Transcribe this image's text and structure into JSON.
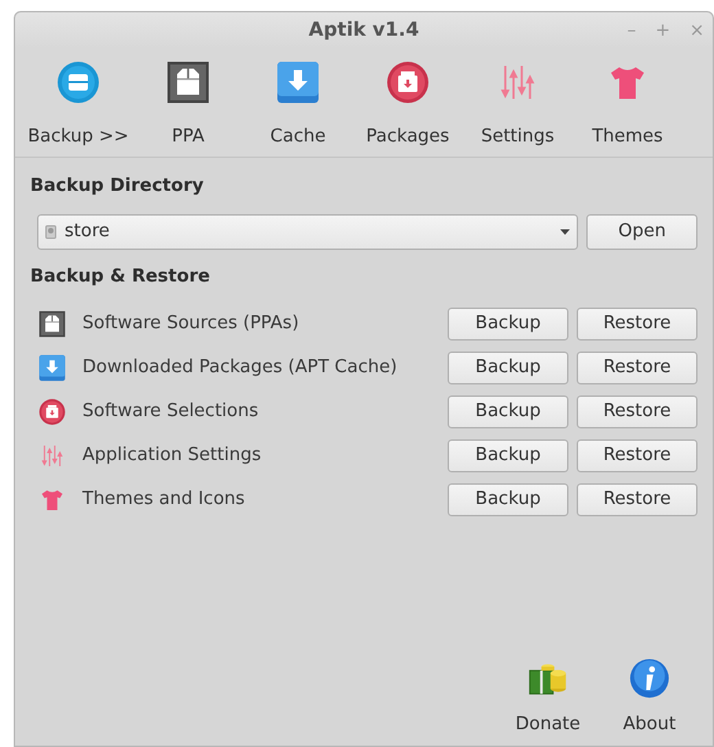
{
  "window": {
    "title": "Aptik v1.4",
    "controls": [
      "–",
      "+",
      "×"
    ]
  },
  "toolbar": [
    {
      "label": "Backup >>",
      "kind": "box-round"
    },
    {
      "label": "PPA",
      "kind": "box-square"
    },
    {
      "label": "Cache",
      "kind": "download"
    },
    {
      "label": "Packages",
      "kind": "package"
    },
    {
      "label": "Settings",
      "kind": "sliders"
    },
    {
      "label": "Themes",
      "kind": "shirt"
    }
  ],
  "backup_directory": {
    "heading": "Backup Directory",
    "value": "store",
    "open_button": "Open"
  },
  "backup_restore": {
    "heading": "Backup & Restore",
    "rows": [
      {
        "label": "Software Sources (PPAs)",
        "kind": "box-square",
        "backup": "Backup",
        "restore": "Restore"
      },
      {
        "label": "Downloaded Packages (APT Cache)",
        "kind": "download",
        "backup": "Backup",
        "restore": "Restore"
      },
      {
        "label": "Software Selections",
        "kind": "package",
        "backup": "Backup",
        "restore": "Restore"
      },
      {
        "label": "Application Settings",
        "kind": "sliders",
        "backup": "Backup",
        "restore": "Restore"
      },
      {
        "label": "Themes and Icons",
        "kind": "shirt",
        "backup": "Backup",
        "restore": "Restore"
      }
    ]
  },
  "footer": [
    {
      "label": "Donate",
      "kind": "money"
    },
    {
      "label": "About",
      "kind": "info"
    }
  ]
}
